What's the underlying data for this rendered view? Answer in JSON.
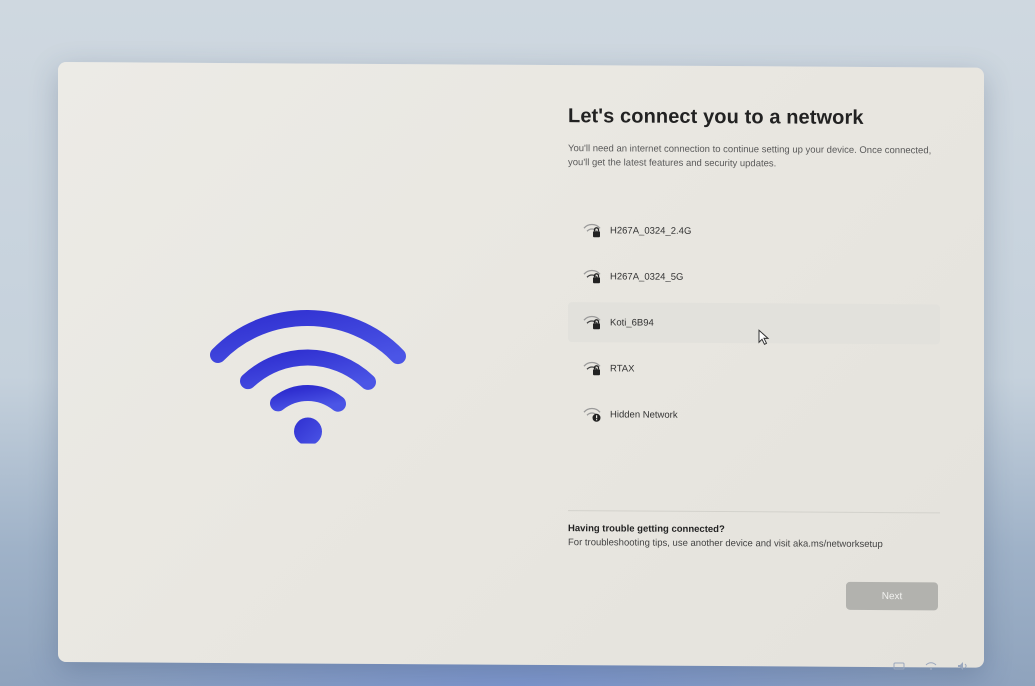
{
  "page": {
    "title": "Let's connect you to a network",
    "subtitle": "You'll need an internet connection to continue setting up your device. Once connected, you'll get the latest features and security updates."
  },
  "networks": [
    {
      "name": "H267A_0324_2.4G",
      "icon": "wifi-lock-icon",
      "selected": false
    },
    {
      "name": "H267A_0324_5G",
      "icon": "wifi-lock-icon",
      "selected": false
    },
    {
      "name": "Koti_6B94",
      "icon": "wifi-lock-icon",
      "selected": true
    },
    {
      "name": "RTAX",
      "icon": "wifi-lock-icon",
      "selected": false
    },
    {
      "name": "Hidden Network",
      "icon": "wifi-hidden-icon",
      "selected": false
    }
  ],
  "help": {
    "title": "Having trouble getting connected?",
    "text": "For troubleshooting tips, use another device and visit aka.ms/networksetup"
  },
  "buttons": {
    "next_label": "Next"
  },
  "colors": {
    "wifi_hero": "#3b3fd6",
    "card_bg": "#eae8e3",
    "selected_row": "#e2e1dc",
    "button_disabled": "#b2b2ae"
  }
}
